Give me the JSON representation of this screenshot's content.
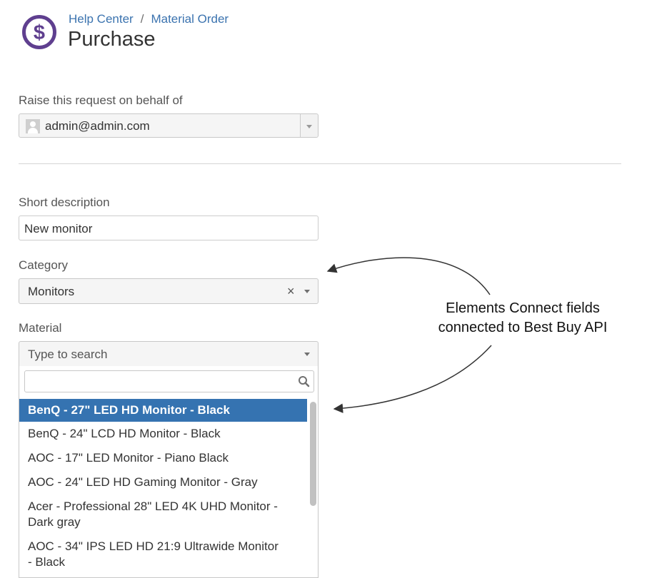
{
  "header": {
    "breadcrumb": [
      "Help Center",
      "Material Order"
    ],
    "breadcrumb_separator": "/",
    "title": "Purchase",
    "logo_icon": "dollar-icon",
    "accent_color": "#5f3f8f"
  },
  "on_behalf": {
    "label": "Raise this request on behalf of",
    "value": "admin@admin.com"
  },
  "short_description": {
    "label": "Short description",
    "value": "New monitor"
  },
  "category": {
    "label": "Category",
    "value": "Monitors",
    "clear_symbol": "×"
  },
  "material": {
    "label": "Material",
    "placeholder": "Type to search",
    "search_value": "",
    "options": [
      "BenQ - 27\" LED HD Monitor - Black",
      "BenQ - 24\" LCD HD Monitor - Black",
      "AOC - 17\" LED Monitor - Piano Black",
      "AOC - 24\" LED HD Gaming Monitor - Gray",
      "Acer - Professional 28\" LED 4K UHD Monitor - Dark gray",
      "AOC - 34\" IPS LED HD 21:9 Ultrawide Monitor - Black"
    ],
    "selected_color": "#3573b1"
  },
  "annotation": {
    "text": "Elements Connect fields connected to Best Buy API"
  }
}
